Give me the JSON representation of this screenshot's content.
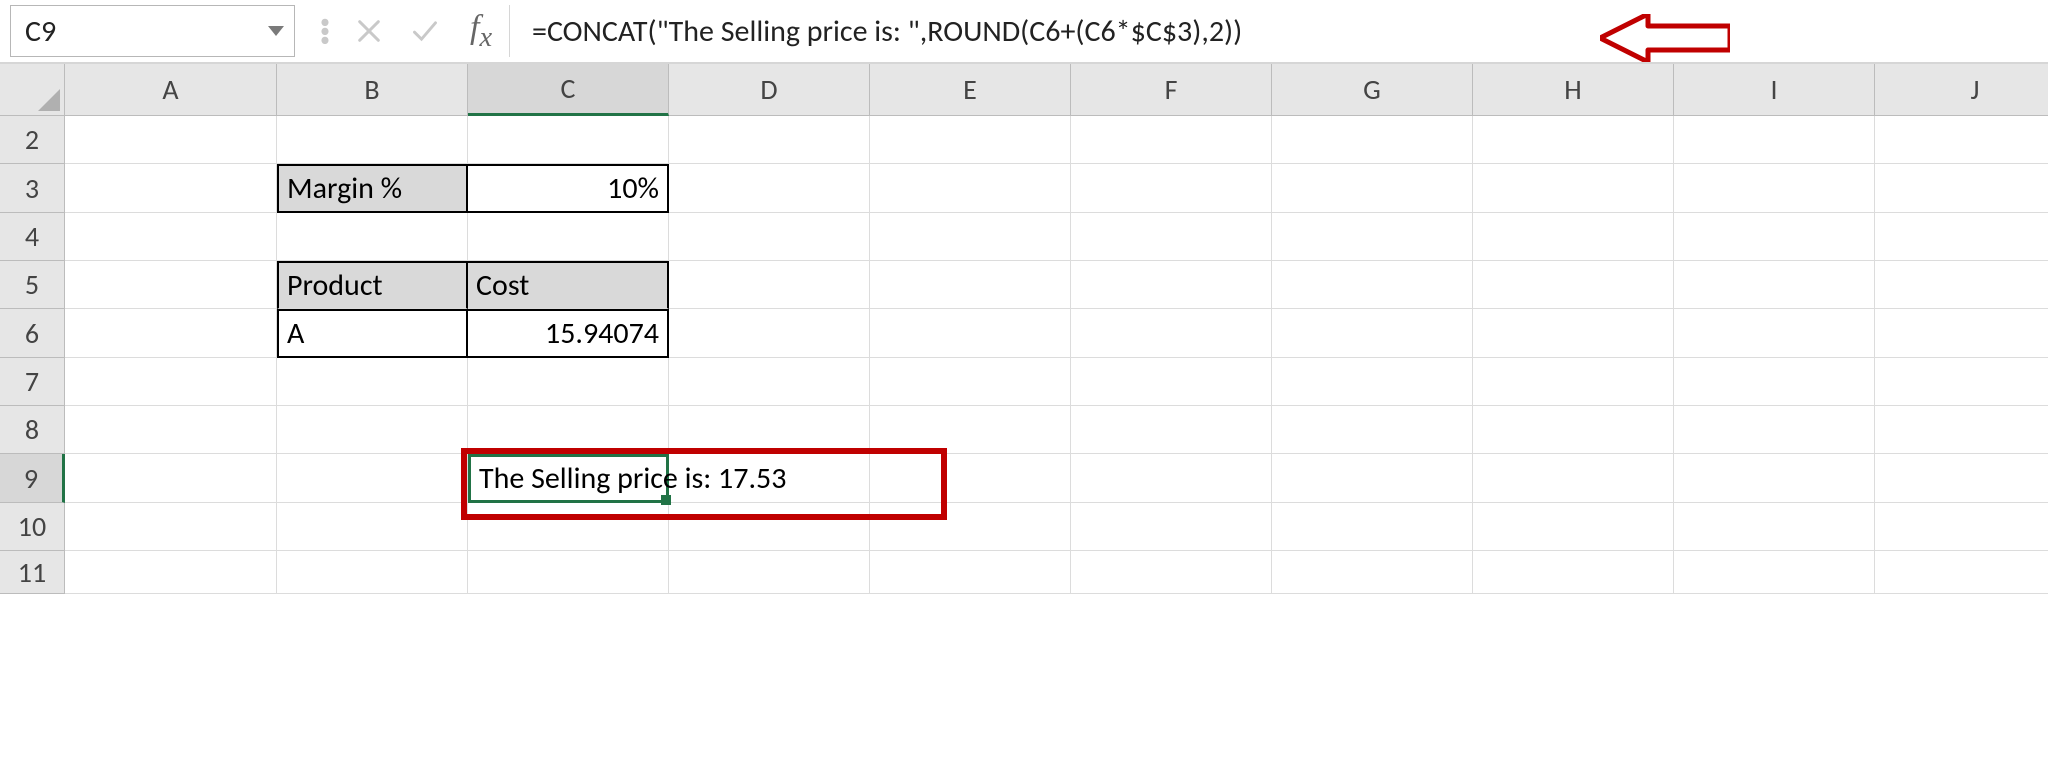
{
  "nameBox": {
    "value": "C9"
  },
  "formulaBar": {
    "text": "=CONCAT(\"The Selling price is: \",ROUND(C6+(C6*$C$3),2))"
  },
  "columns": [
    "A",
    "B",
    "C",
    "D",
    "E",
    "F",
    "G",
    "H",
    "I",
    "J"
  ],
  "rows": [
    "2",
    "3",
    "4",
    "5",
    "6",
    "7",
    "8",
    "9",
    "10",
    "11"
  ],
  "cells": {
    "B3": "Margin %",
    "C3": "10%",
    "B5": "Product",
    "C5": "Cost",
    "B6": "A",
    "C6": "15.94074",
    "C9": "The Selling price is: 17.53"
  },
  "activeCell": "C9"
}
